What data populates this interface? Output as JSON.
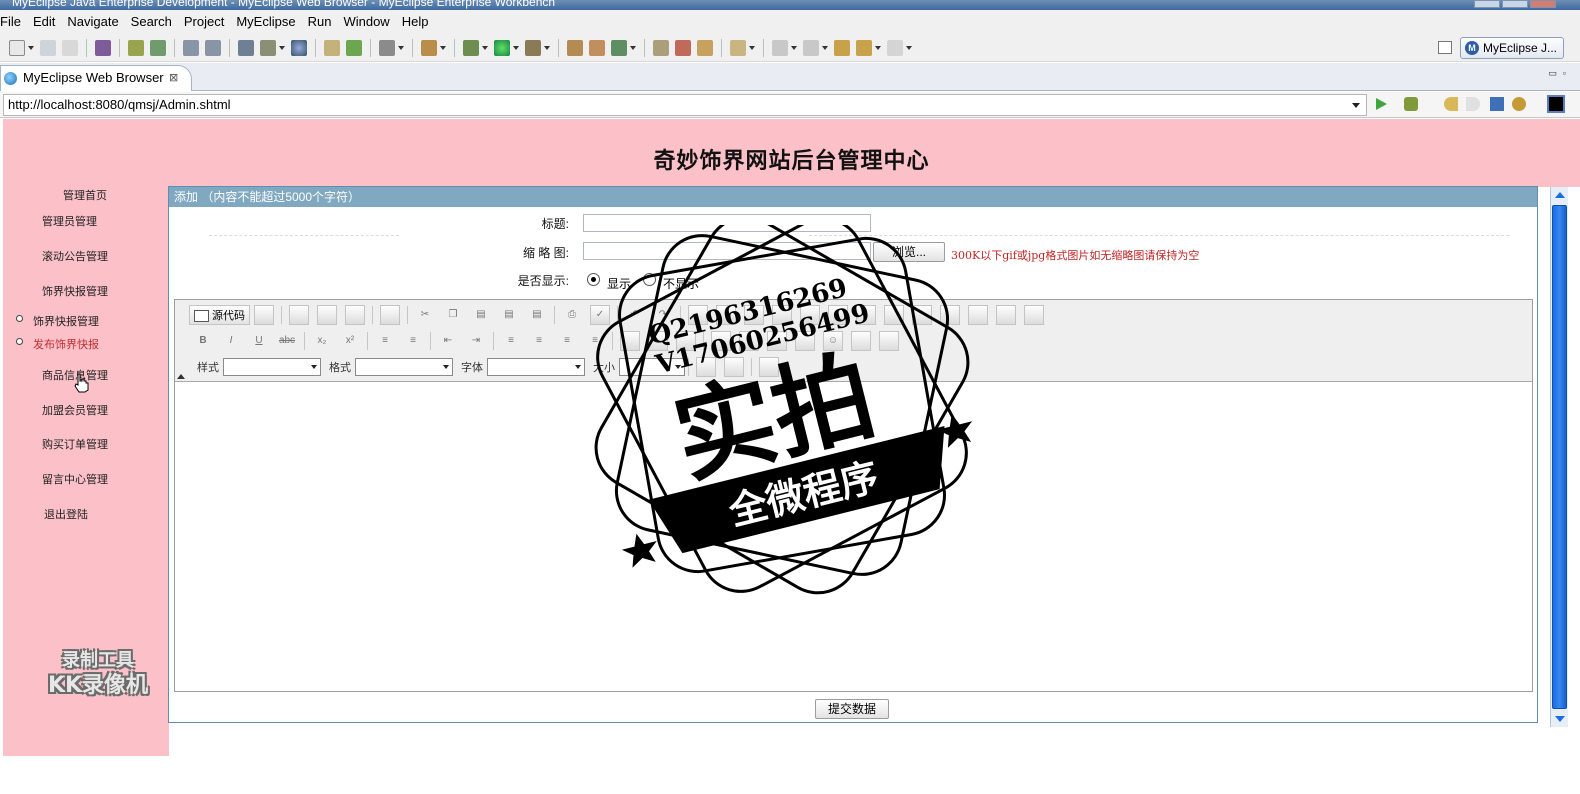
{
  "window": {
    "title": "MyEclipse Java Enterprise Development - MyEclipse Web Browser - MyEclipse Enterprise Workbench"
  },
  "menu": [
    "File",
    "Edit",
    "Navigate",
    "Search",
    "Project",
    "MyEclipse",
    "Run",
    "Window",
    "Help"
  ],
  "perspective": {
    "label": "MyEclipse J..."
  },
  "editor_tab": {
    "label": "MyEclipse Web Browser",
    "close": "⊠"
  },
  "address": {
    "url": "http://localhost:8080/qmsj/Admin.shtml"
  },
  "page": {
    "title": "奇妙饰界网站后台管理中心",
    "sidebar": {
      "home": "管理首页",
      "items": [
        "管理员管理",
        "滚动公告管理",
        "饰界快报管理"
      ],
      "sub_items": [
        "饰界快报管理",
        "发布饰界快报"
      ],
      "items2": [
        "商品信息管理",
        "加盟会员管理",
        "购买订单管理",
        "留言中心管理",
        "退出登陆"
      ]
    },
    "form": {
      "panel_title": "添加 （内容不能超过5000个字符）",
      "title_label": "标题:",
      "title_value": "",
      "thumb_label": "缩 略 图:",
      "thumb_value": "",
      "browse_button": "浏览...",
      "thumb_hint": "300K以下gif或jpg格式图片如无缩略图请保持为空",
      "show_label": "是否显示:",
      "show_option": "显示",
      "hide_option": "不显示",
      "show_selected": "显示",
      "submit": "提交数据"
    },
    "editor": {
      "source_button": "源代码",
      "style_label": "样式",
      "format_label": "格式",
      "font_label": "字体",
      "size_label": "大小"
    }
  },
  "overlays": {
    "stamp_qq": "Q2196316269",
    "stamp_v": "V17060256499",
    "stamp_main": "实拍",
    "stamp_sub": "全微程序",
    "recorder_line1": "录制工具",
    "recorder_line2": "KK录像机"
  },
  "colors": {
    "header_pink": "#fbc0c8",
    "panel_head": "#80a8c0",
    "hint_red": "#c02525",
    "scroll_blue": "#1b6ce3"
  }
}
